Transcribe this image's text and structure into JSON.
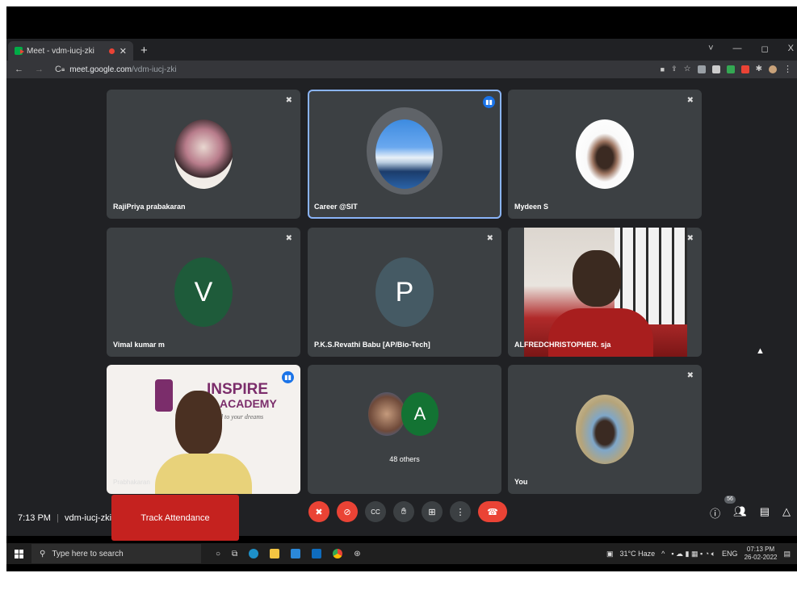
{
  "browser": {
    "tab_title": "Meet - vdm-iucj-zki",
    "url_domain": "meet.google.com",
    "url_path": "/vdm-iucj-zki",
    "window_controls": [
      "˅",
      "—",
      "◻",
      "X"
    ]
  },
  "participants": [
    {
      "name": "RajiPriya prabakaran",
      "type": "photo",
      "muted": true
    },
    {
      "name": "Career @SIT",
      "type": "photo",
      "muted": false,
      "speaking": true
    },
    {
      "name": "Mydeen S",
      "type": "photo",
      "muted": true
    },
    {
      "name": "Vimal kumar m",
      "type": "letter",
      "letter": "V",
      "color": "#1e5b3a",
      "muted": true
    },
    {
      "name": "P.K.S.Revathi Babu [AP/Bio-Tech]",
      "type": "letter",
      "letter": "P",
      "color": "#455a64",
      "muted": true
    },
    {
      "name": "ALFREDCHRISTOPHER. sja",
      "type": "video",
      "muted": true
    },
    {
      "name": "Prabhakaran",
      "type": "video",
      "muted": false,
      "speaking": true,
      "logo_line1": "INSPIRE",
      "logo_line2": "ACADEMY",
      "logo_tag": "d to your dreams"
    },
    {
      "name": "48 others",
      "type": "others",
      "letter": "A",
      "color": "#137333"
    },
    {
      "name": "You",
      "type": "photo",
      "muted": true
    }
  ],
  "meeting": {
    "time": "7:13 PM",
    "separator": "|",
    "code": "vdm-iucj-zki",
    "track_attendance": "Track Attendance",
    "participants_count": "56"
  },
  "taskbar": {
    "search_placeholder": "Type here to search",
    "weather": "31°C  Haze",
    "lang": "ENG",
    "time": "07:13 PM",
    "date": "26-02-2022"
  }
}
